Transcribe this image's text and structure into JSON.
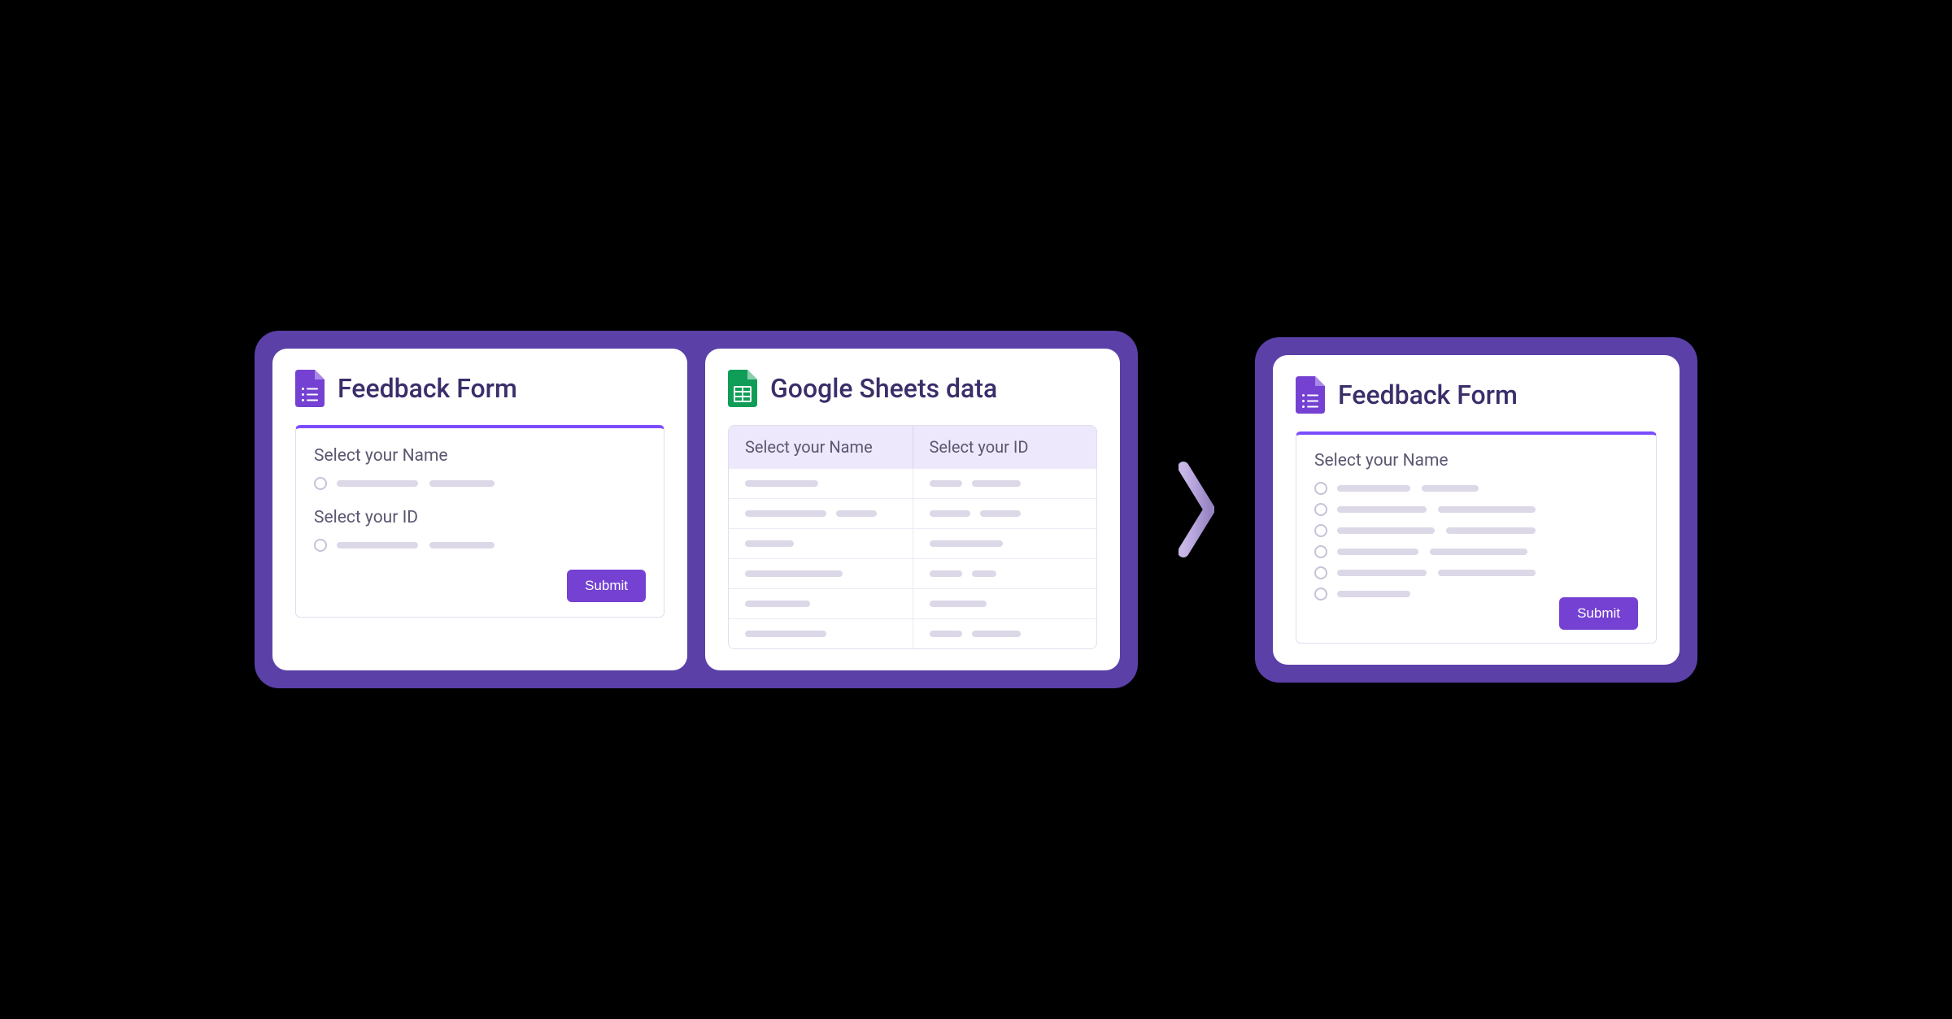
{
  "leftPanel": {
    "formCard": {
      "title": "Feedback Form",
      "questions": [
        {
          "label": "Select your Name"
        },
        {
          "label": "Select your ID"
        }
      ],
      "submitLabel": "Submit"
    },
    "sheetsCard": {
      "title": "Google Sheets data",
      "headers": [
        "Select your Name",
        "Select your ID"
      ],
      "rowCount": 6
    }
  },
  "rightPanel": {
    "formCard": {
      "title": "Feedback Form",
      "question": {
        "label": "Select your Name"
      },
      "optionCount": 6,
      "submitLabel": "Submit"
    }
  },
  "colors": {
    "purpleFrame": "#5b40a8",
    "accent": "#7c4dff",
    "buttonBg": "#7541d3",
    "sheetsGreen": "#0f9d58",
    "formsPurple": "#7541d3"
  }
}
